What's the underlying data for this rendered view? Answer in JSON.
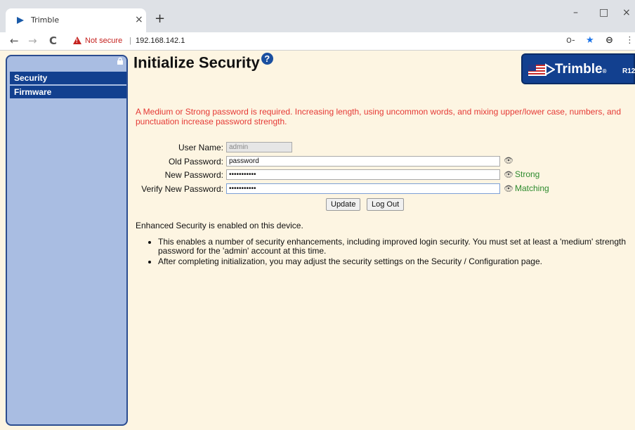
{
  "browser": {
    "tab_title": "Trimble",
    "tab_close": "×",
    "new_tab": "+",
    "win_minimize": "–",
    "win_maximize": "□",
    "win_close": "×",
    "back": "←",
    "forward": "→",
    "reload": "C",
    "not_secure": "Not secure",
    "separator": "|",
    "url": "192.168.142.1",
    "key_icon": "o‑",
    "star_icon": "★",
    "profile_icon": "⊖",
    "menu_icon": "⋮"
  },
  "sidebar": {
    "items": [
      {
        "label": "Security"
      },
      {
        "label": "Firmware"
      }
    ]
  },
  "header": {
    "title": "Initialize Security",
    "help": "?",
    "logo": "Trimble",
    "logo_mark": "®",
    "model": "R12"
  },
  "form": {
    "warning": "A Medium or Strong password is required. Increasing length, using uncommon words, and mixing upper/lower case, numbers, and punctuation increase password strength.",
    "username_label": "User Name:",
    "username_value": "admin",
    "old_password_label": "Old Password:",
    "old_password_value": "password",
    "new_password_label": "New Password:",
    "new_password_value": "•••••••••••",
    "verify_password_label": "Verify New Password:",
    "verify_password_value": "•••••••••••",
    "eye_icon": "👁",
    "strength_status": "Strong",
    "match_status": "Matching",
    "update_label": "Update",
    "logout_label": "Log Out"
  },
  "info": {
    "enabled_text": "Enhanced Security is enabled on this device.",
    "bullets": [
      "This enables a number of security enhancements, including improved login security. You must set at least a 'medium' strength password for the 'admin' account at this time.",
      "After completing initialization, you may adjust the security settings on the Security / Configuration page."
    ]
  },
  "colors": {
    "background": "#fdf5e2",
    "sidebar_bg": "#a9bde2",
    "nav_item": "#12408f",
    "warning": "#e53935",
    "success": "#2e8b2e"
  }
}
